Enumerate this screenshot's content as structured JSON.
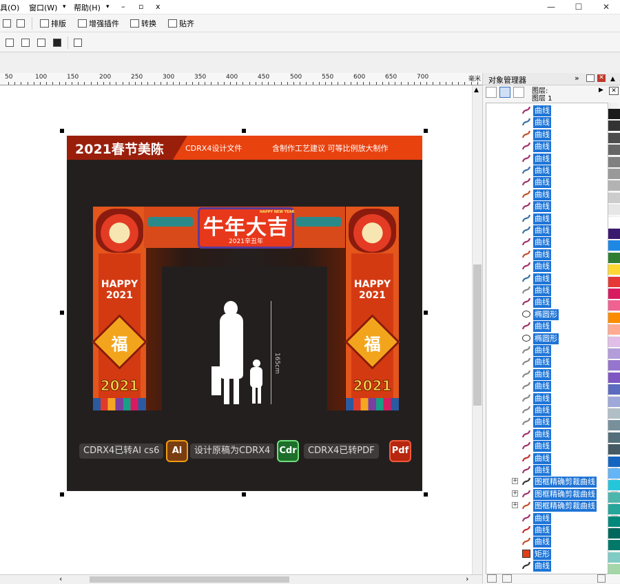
{
  "menu": {
    "item1": "具(O)",
    "item2": "窗口(W)",
    "item3": "帮助(H)",
    "min": "–",
    "restore": "▫",
    "close": "x"
  },
  "window_controls": {
    "minimize": "—",
    "maximize": "☐",
    "close": "✕"
  },
  "toolbar1": {
    "typeset": "排版",
    "plugin": "增强插件",
    "convert": "转换",
    "snap": "贴齐"
  },
  "ruler": {
    "labels": [
      "50",
      "100",
      "150",
      "200",
      "250",
      "300",
      "350",
      "400",
      "450",
      "500",
      "550",
      "600",
      "650",
      "700",
      "毫米"
    ]
  },
  "artwork": {
    "banner_year": "2021春节美陈",
    "banner_file": "CDRX4设计文件",
    "banner_note": "含制作工艺建议 可等比例放大制作",
    "main_title": "牛年大吉",
    "sub_title": "2021辛丑年",
    "happy": "HAPPY NEW YEAR",
    "pillar_text": "HAPPY 2021",
    "fu": "福",
    "year": "2021",
    "dimension": "165cm",
    "pill1": "CDRX4已转AI cs6",
    "badge1": "Ai",
    "pill2": "设计原稿为CDRX4",
    "badge2": "Cdr",
    "pill3": "CDRX4已转PDF",
    "badge3": "Pdf"
  },
  "docker": {
    "title": "对象管理器",
    "layer_label": "图层:",
    "layer_name": "图层 1",
    "items": [
      {
        "type": "curve",
        "label": "曲线",
        "color": "#a0306a"
      },
      {
        "type": "curve",
        "label": "曲线",
        "color": "#3a6fa0"
      },
      {
        "type": "curve",
        "label": "曲线",
        "color": "#c0502a"
      },
      {
        "type": "curve",
        "label": "曲线",
        "color": "#a0306a"
      },
      {
        "type": "curve",
        "label": "曲线",
        "color": "#a0306a"
      },
      {
        "type": "curve",
        "label": "曲线",
        "color": "#3a6fa0"
      },
      {
        "type": "curve",
        "label": "曲线",
        "color": "#a0306a"
      },
      {
        "type": "curve",
        "label": "曲线",
        "color": "#c0502a"
      },
      {
        "type": "curve",
        "label": "曲线",
        "color": "#a0306a"
      },
      {
        "type": "curve",
        "label": "曲线",
        "color": "#3a6fa0"
      },
      {
        "type": "curve",
        "label": "曲线",
        "color": "#3a6fa0"
      },
      {
        "type": "curve",
        "label": "曲线",
        "color": "#a0306a"
      },
      {
        "type": "curve",
        "label": "曲线",
        "color": "#c0502a"
      },
      {
        "type": "curve",
        "label": "曲线",
        "color": "#a0306a"
      },
      {
        "type": "curve",
        "label": "曲线",
        "color": "#3a6fa0"
      },
      {
        "type": "curve",
        "label": "曲线",
        "color": "#888888"
      },
      {
        "type": "curve",
        "label": "曲线",
        "color": "#a0306a"
      },
      {
        "type": "ellipse",
        "label": "椭圆形",
        "color": "#ffffff"
      },
      {
        "type": "curve",
        "label": "曲线",
        "color": "#a0306a"
      },
      {
        "type": "ellipse",
        "label": "椭圆形",
        "color": "#ffffff"
      },
      {
        "type": "curve",
        "label": "曲线",
        "color": "#888888"
      },
      {
        "type": "curve",
        "label": "曲线",
        "color": "#888888"
      },
      {
        "type": "curve",
        "label": "曲线",
        "color": "#888888"
      },
      {
        "type": "curve",
        "label": "曲线",
        "color": "#888888"
      },
      {
        "type": "curve",
        "label": "曲线",
        "color": "#888888"
      },
      {
        "type": "curve",
        "label": "曲线",
        "color": "#888888"
      },
      {
        "type": "curve",
        "label": "曲线",
        "color": "#888888"
      },
      {
        "type": "curve",
        "label": "曲线",
        "color": "#a0306a"
      },
      {
        "type": "curve",
        "label": "曲线",
        "color": "#a0306a"
      },
      {
        "type": "curve",
        "label": "曲线",
        "color": "#c0302a"
      },
      {
        "type": "curve",
        "label": "曲线",
        "color": "#a0306a"
      },
      {
        "type": "group",
        "label": "图框精确剪裁曲线",
        "color": "#333333"
      },
      {
        "type": "group",
        "label": "图框精确剪裁曲线",
        "color": "#a0306a"
      },
      {
        "type": "group",
        "label": "图框精确剪裁曲线",
        "color": "#c0502a"
      },
      {
        "type": "curve",
        "label": "曲线",
        "color": "#a0306a"
      },
      {
        "type": "curve",
        "label": "曲线",
        "color": "#c0302a"
      },
      {
        "type": "curve",
        "label": "曲线",
        "color": "#c0502a"
      },
      {
        "type": "rect",
        "label": "矩形",
        "color": "#e0401a"
      },
      {
        "type": "curve",
        "label": "曲线",
        "color": "#333333"
      }
    ]
  },
  "palette": [
    "#1a1a1a",
    "#333333",
    "#4d4d4d",
    "#666666",
    "#808080",
    "#999999",
    "#b3b3b3",
    "#cccccc",
    "#e6e6e6",
    "#ffffff",
    "#3a1a6e",
    "#1e88e5",
    "#2e7d32",
    "#fdd835",
    "#e53935",
    "#d81b60",
    "#f06292",
    "#fb8c00",
    "#ffab91",
    "#e1bee7",
    "#b39ddb",
    "#9575cd",
    "#7e57c2",
    "#5c6bc0",
    "#9fa8da",
    "#b0bec5",
    "#78909c",
    "#546e7a",
    "#455a64",
    "#1565c0",
    "#64b5f6",
    "#26c6da",
    "#4db6ac",
    "#26a69a",
    "#00897b",
    "#00695c",
    "#00796b",
    "#80cbc4",
    "#a5d6a7"
  ]
}
